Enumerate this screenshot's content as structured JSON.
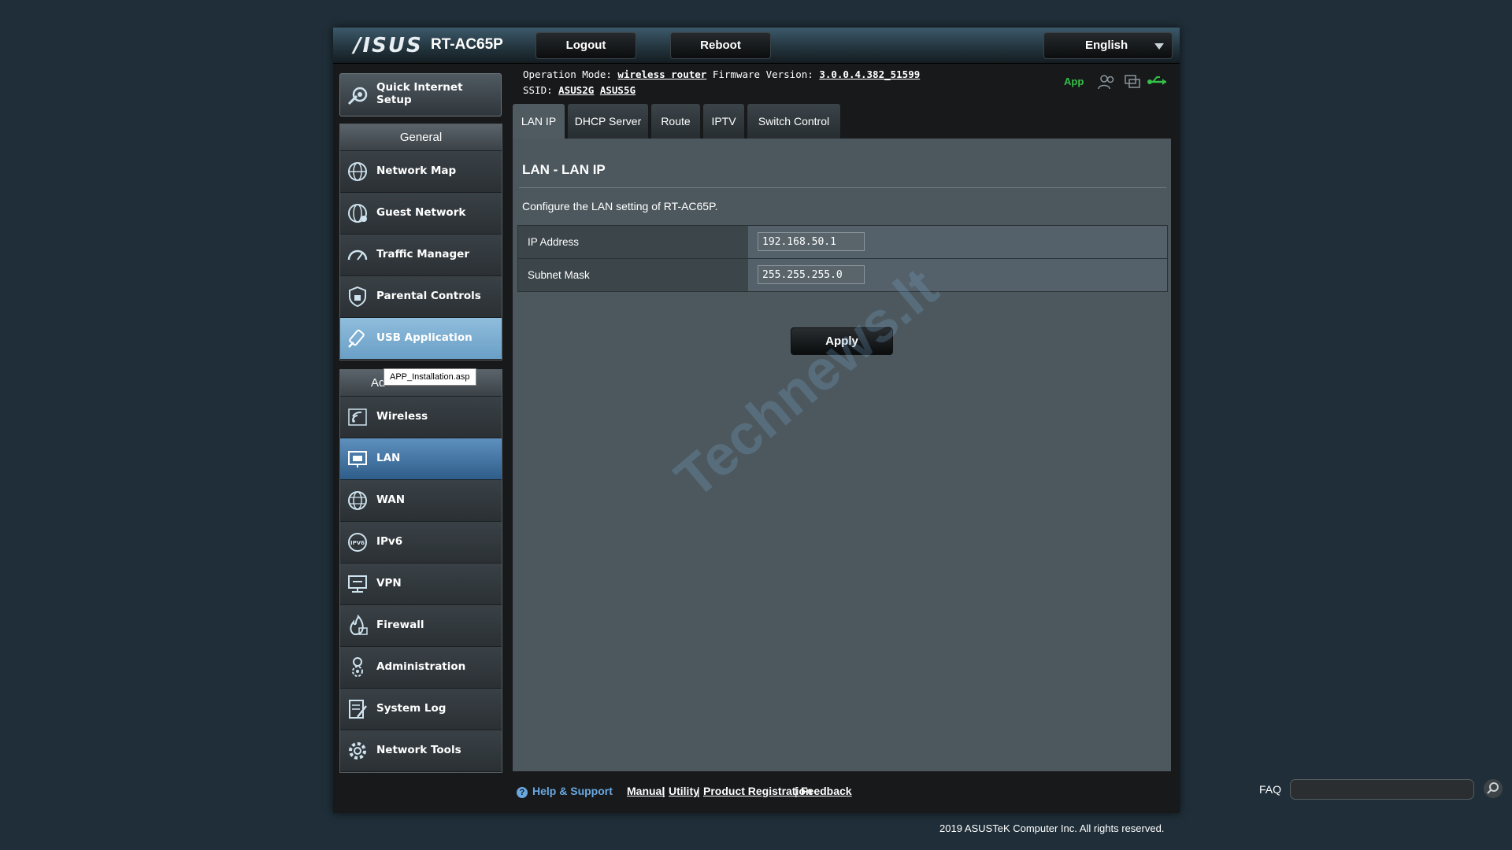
{
  "header": {
    "logo": "/ISUS",
    "model": "RT-AC65P",
    "logout_label": "Logout",
    "reboot_label": "Reboot",
    "language": "English"
  },
  "info": {
    "op_mode_label": "Operation Mode:",
    "op_mode_value": "wireless router",
    "fw_label": "Firmware Version:",
    "fw_value": "3.0.0.4.382_51599",
    "ssid_label": "SSID:",
    "ssid_2g": "ASUS2G",
    "ssid_5g": "ASUS5G",
    "app_label": "App"
  },
  "sidebar": {
    "quick_setup": "Quick Internet Setup",
    "general_head": "General",
    "general_items": [
      {
        "label": "Network Map",
        "icon": "globe-icon"
      },
      {
        "label": "Guest Network",
        "icon": "guest-globe-icon"
      },
      {
        "label": "Traffic Manager",
        "icon": "gauge-icon"
      },
      {
        "label": "Parental Controls",
        "icon": "lock-icon"
      },
      {
        "label": "USB Application",
        "icon": "usb-icon"
      }
    ],
    "advanced_head_visible": "Ad",
    "tooltip": "APP_Installation.asp",
    "advanced_items": [
      {
        "label": "Wireless",
        "icon": "wifi-icon"
      },
      {
        "label": "LAN",
        "icon": "lan-icon"
      },
      {
        "label": "WAN",
        "icon": "wan-globe-icon"
      },
      {
        "label": "IPv6",
        "icon": "ipv6-icon"
      },
      {
        "label": "VPN",
        "icon": "vpn-icon"
      },
      {
        "label": "Firewall",
        "icon": "fire-icon"
      },
      {
        "label": "Administration",
        "icon": "admin-icon"
      },
      {
        "label": "System Log",
        "icon": "log-icon"
      },
      {
        "label": "Network Tools",
        "icon": "tools-gear-icon"
      }
    ]
  },
  "tabs": [
    "LAN IP",
    "DHCP Server",
    "Route",
    "IPTV",
    "Switch Control"
  ],
  "main": {
    "title": "LAN - LAN IP",
    "description": "Configure the LAN setting of RT-AC65P.",
    "fields": [
      {
        "label": "IP Address",
        "value": "192.168.50.1"
      },
      {
        "label": "Subnet Mask",
        "value": "255.255.255.0"
      }
    ],
    "apply_label": "Apply",
    "watermark": "Technews.lt"
  },
  "footer": {
    "help": "Help & Support",
    "manual": "Manual",
    "utility": "Utility",
    "product_registration": "Product Registration",
    "feedback": "Feedback",
    "separator": "|",
    "faq": "FAQ",
    "copyright": "2019 ASUSTeK Computer Inc. All rights reserved."
  },
  "colors": {
    "active_menu": "#3f72a4",
    "usb_menu": "#7aaed3",
    "app_green": "#35c04a"
  }
}
